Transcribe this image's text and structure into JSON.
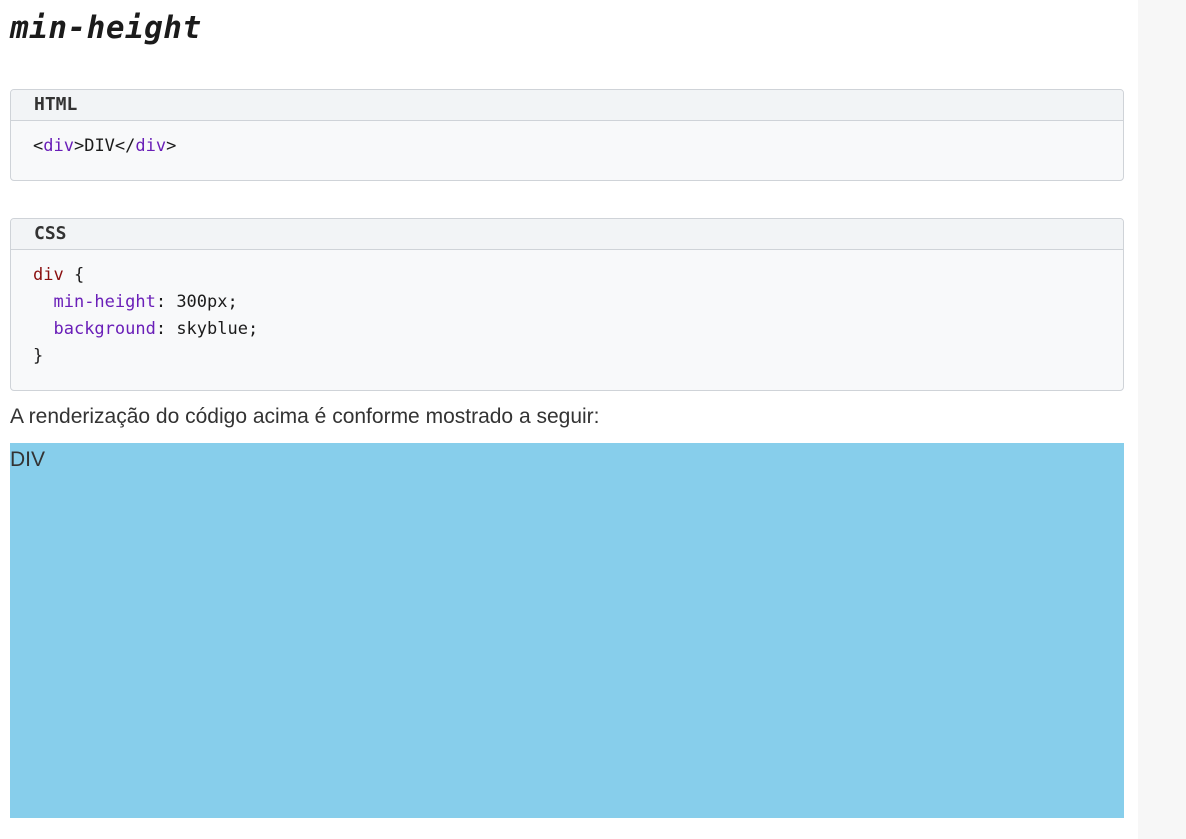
{
  "heading": "min-height",
  "html_block": {
    "label": "HTML",
    "open_bracket": "<",
    "tag_open": "div",
    "mid": ">DIV</",
    "tag_close": "div",
    "close_bracket": ">"
  },
  "css_block": {
    "label": "CSS",
    "selector": "div",
    "open_brace": " {",
    "rules": [
      {
        "property": "min-height",
        "value": ": 300px;"
      },
      {
        "property": "background",
        "value": ": skyblue;"
      }
    ],
    "close_brace": "}"
  },
  "caption": "A renderização do código acima é conforme mostrado a seguir:",
  "result": {
    "text": "DIV",
    "background_color": "#87ceeb"
  }
}
